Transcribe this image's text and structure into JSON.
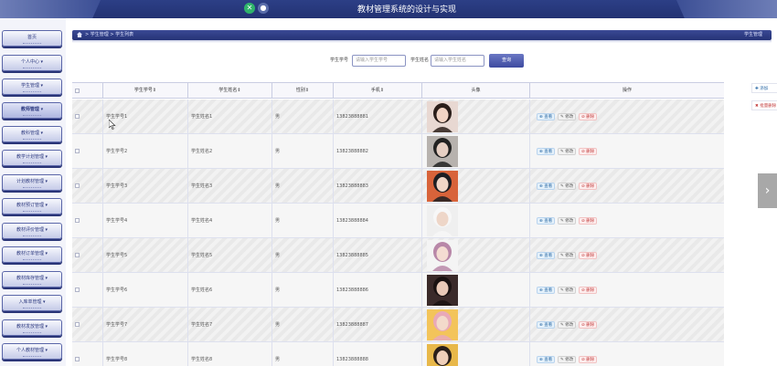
{
  "header": {
    "title": "教材管理系统的设计与实现",
    "icons": [
      "close-icon",
      "user-icon"
    ],
    "accent": "#2c3f86"
  },
  "sidebar": {
    "items": [
      {
        "label": "首页"
      },
      {
        "label": "个人中心 ▾"
      },
      {
        "label": "学生管理 ▾"
      },
      {
        "label": "教师管理 ▾",
        "active": true
      },
      {
        "label": "教科管理 ▾"
      },
      {
        "label": "教学计划管理 ▾"
      },
      {
        "label": "计划教材管理 ▾"
      },
      {
        "label": "教材预订管理 ▾"
      },
      {
        "label": "教材评价管理 ▾"
      },
      {
        "label": "教材订单管理 ▾"
      },
      {
        "label": "教材库存管理 ▾"
      },
      {
        "label": "入库单管理 ▾"
      },
      {
        "label": "教材发放管理 ▾"
      },
      {
        "label": "个人教材管理 ▾"
      }
    ]
  },
  "breadcrumb": {
    "path": "> 学生管理 > 学生列表",
    "right": "学生管理"
  },
  "search": {
    "id_label": "学生学号",
    "id_placeholder": "请输入学生学号",
    "name_label": "学生姓名",
    "name_placeholder": "请输入学生姓名",
    "button": "查询"
  },
  "table": {
    "headers": [
      "",
      "学生学号⇕",
      "学生姓名⇕",
      "性别⇕",
      "手机⇕",
      "头像",
      "操作"
    ],
    "rows": [
      {
        "id": "学生学号1",
        "name": "学生姓名1",
        "gender": "男",
        "phone": "13823888881",
        "avatar": {
          "bg": "#e8d8d2",
          "hair": "#2a1e1a",
          "skin": "#f2d4c4"
        }
      },
      {
        "id": "学生学号2",
        "name": "学生姓名2",
        "gender": "男",
        "phone": "13823888882",
        "avatar": {
          "bg": "#b7b2ae",
          "hair": "#222222",
          "skin": "#e6cfc3"
        }
      },
      {
        "id": "学生学号3",
        "name": "学生姓名3",
        "gender": "男",
        "phone": "13823888883",
        "avatar": {
          "bg": "#d8633a",
          "hair": "#1e1e22",
          "skin": "#f0d6c6"
        }
      },
      {
        "id": "学生学号4",
        "name": "学生姓名4",
        "gender": "男",
        "phone": "13823888884",
        "avatar": {
          "bg": "#efefef",
          "hair": "#f7f7f7",
          "skin": "#eed6c8"
        }
      },
      {
        "id": "学生学号5",
        "name": "学生姓名5",
        "gender": "男",
        "phone": "13823888885",
        "avatar": {
          "bg": "#f4f4f4",
          "hair": "#b887a8",
          "skin": "#f4dcd2"
        }
      },
      {
        "id": "学生学号6",
        "name": "学生姓名6",
        "gender": "男",
        "phone": "13823888886",
        "avatar": {
          "bg": "#3a2a2a",
          "hair": "#1a1212",
          "skin": "#e9c9b8"
        }
      },
      {
        "id": "学生学号7",
        "name": "学生姓名7",
        "gender": "男",
        "phone": "13823888887",
        "avatar": {
          "bg": "#f3c45a",
          "hair": "#e9a9b8",
          "skin": "#f3dacb"
        }
      },
      {
        "id": "学生学号8",
        "name": "学生姓名8",
        "gender": "男",
        "phone": "13823888888",
        "avatar": {
          "bg": "#e8b84a",
          "hair": "#2a1f1a",
          "skin": "#efcfb9"
        }
      }
    ],
    "actions": {
      "view": "查看",
      "edit": "修改",
      "delete": "删除"
    }
  },
  "right_panel": {
    "add": "添加",
    "batch_delete": "批量删除"
  }
}
